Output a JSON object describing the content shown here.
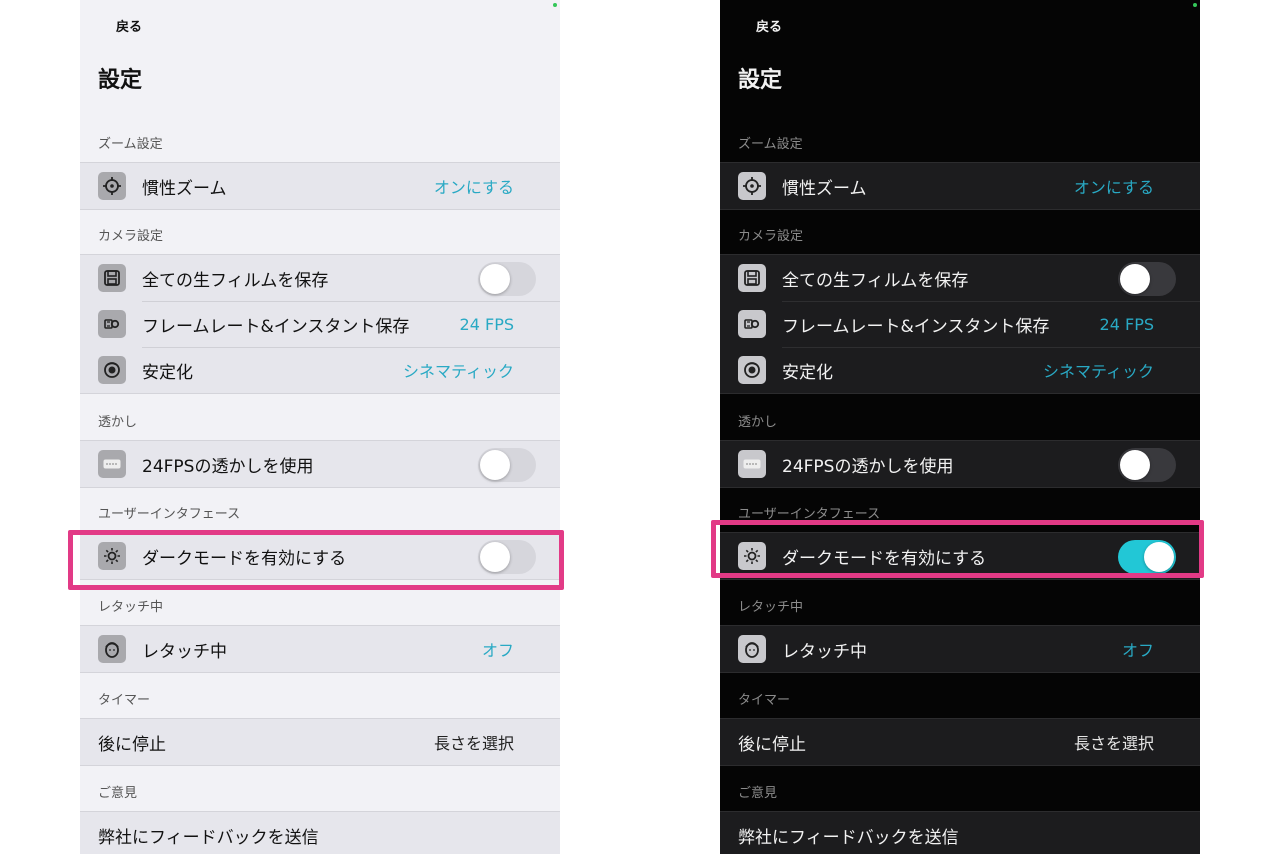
{
  "colors": {
    "accent": "#29a9c4",
    "toggle_on": "#22c7d6",
    "highlight": "#e23a86",
    "light_bg": "#f2f2f6",
    "dark_bg": "#050505"
  },
  "light": {
    "back_label": "戻る",
    "title": "設定",
    "sections": {
      "zoom": {
        "header": "ズーム設定",
        "inertia": {
          "icon": "crosshair-icon",
          "label": "慣性ズーム",
          "value": "オンにする"
        }
      },
      "camera": {
        "header": "カメラ設定",
        "save_raw": {
          "icon": "save-icon",
          "label": "全ての生フィルムを保存",
          "toggle": false
        },
        "framerate": {
          "icon": "film-reel-icon",
          "label": "フレームレート&インスタント保存",
          "value": "24 FPS"
        },
        "stabilize": {
          "icon": "stabilize-icon",
          "label": "安定化",
          "value": "シネマティック"
        }
      },
      "watermark": {
        "header": "透かし",
        "use_watermark": {
          "icon": "watermark-icon",
          "label": "24FPSの透かしを使用",
          "toggle": false
        }
      },
      "ui": {
        "header": "ユーザーインタフェース",
        "dark_mode": {
          "icon": "brightness-icon",
          "label": "ダークモードを有効にする",
          "toggle": false
        }
      },
      "retouch": {
        "header": "レタッチ中",
        "retouch_row": {
          "icon": "face-icon",
          "label": "レタッチ中",
          "value": "オフ"
        }
      },
      "timer": {
        "header": "タイマー",
        "stop_after": {
          "label": "後に停止",
          "value": "長さを選択"
        }
      },
      "feedback": {
        "header": "ご意見",
        "send": {
          "label": "弊社にフィードバックを送信"
        }
      }
    }
  },
  "dark": {
    "back_label": "戻る",
    "title": "設定",
    "sections": {
      "zoom": {
        "header": "ズーム設定",
        "inertia": {
          "icon": "crosshair-icon",
          "label": "慣性ズーム",
          "value": "オンにする"
        }
      },
      "camera": {
        "header": "カメラ設定",
        "save_raw": {
          "icon": "save-icon",
          "label": "全ての生フィルムを保存",
          "toggle": false
        },
        "framerate": {
          "icon": "film-reel-icon",
          "label": "フレームレート&インスタント保存",
          "value": "24 FPS"
        },
        "stabilize": {
          "icon": "stabilize-icon",
          "label": "安定化",
          "value": "シネマティック"
        }
      },
      "watermark": {
        "header": "透かし",
        "use_watermark": {
          "icon": "watermark-icon",
          "label": "24FPSの透かしを使用",
          "toggle": false
        }
      },
      "ui": {
        "header": "ユーザーインタフェース",
        "dark_mode": {
          "icon": "brightness-icon",
          "label": "ダークモードを有効にする",
          "toggle": true
        }
      },
      "retouch": {
        "header": "レタッチ中",
        "retouch_row": {
          "icon": "face-icon",
          "label": "レタッチ中",
          "value": "オフ"
        }
      },
      "timer": {
        "header": "タイマー",
        "stop_after": {
          "label": "後に停止",
          "value": "長さを選択"
        }
      },
      "feedback": {
        "header": "ご意見",
        "send": {
          "label": "弊社にフィードバックを送信"
        }
      }
    }
  }
}
